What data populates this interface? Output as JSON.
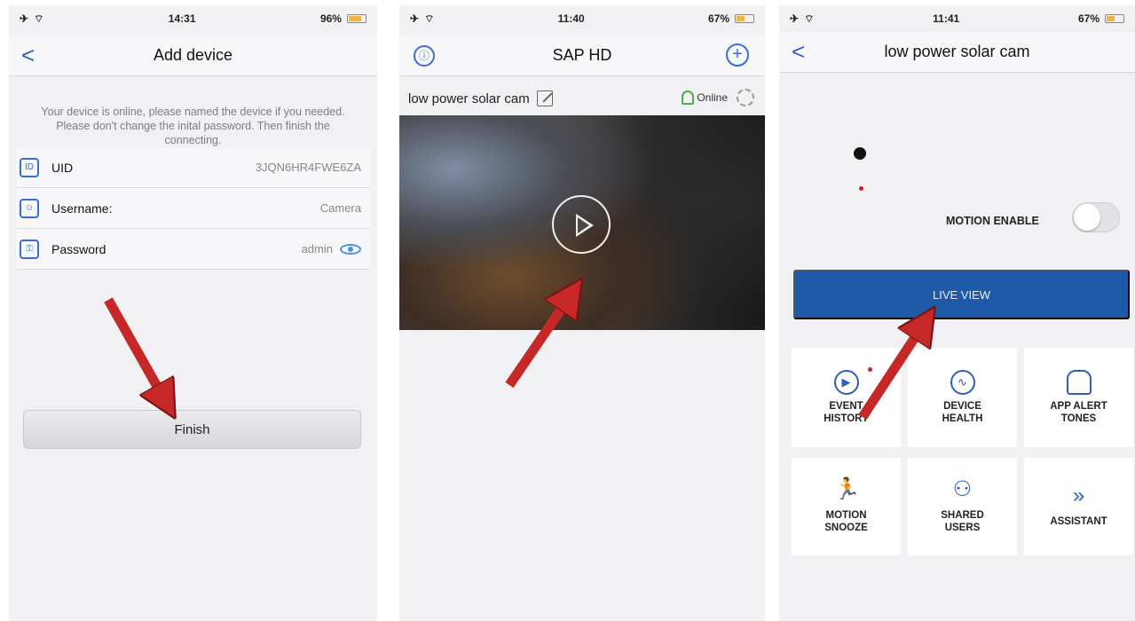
{
  "panel1": {
    "status": {
      "time": "14:31",
      "battery": "96%"
    },
    "nav": {
      "title": "Add device",
      "back": "<"
    },
    "info": "Your device is online, please named the device if you needed. Please don't change the inital password. Then finish the connecting.",
    "rows": [
      {
        "label": "UID",
        "value": "3JQN6HR4FWE6ZA",
        "icon": "uid-icon"
      },
      {
        "label": "Username:",
        "value": "Camera",
        "icon": "user-icon"
      },
      {
        "label": "Password",
        "value": "admin",
        "icon": "password-icon"
      }
    ],
    "finish_label": "Finish"
  },
  "panel2": {
    "status": {
      "time": "11:40",
      "battery": "67%"
    },
    "nav": {
      "title": "SAP HD"
    },
    "device_name": "low power solar cam",
    "status_text": "Online"
  },
  "panel3": {
    "status": {
      "time": "11:41",
      "battery": "67%"
    },
    "nav": {
      "title": "low power solar cam",
      "back": "<"
    },
    "motion_label": "MOTION ENABLE",
    "live_label": "LIVE VIEW",
    "tiles": [
      {
        "label": "EVENT\nHISTORY",
        "icon": "event-history-icon"
      },
      {
        "label": "DEVICE\nHEALTH",
        "icon": "device-health-icon"
      },
      {
        "label": "APP ALERT\nTONES",
        "icon": "bell-icon"
      },
      {
        "label": "MOTION\nSNOOZE",
        "icon": "motion-snooze-icon"
      },
      {
        "label": "SHARED\nUSERS",
        "icon": "shared-users-icon"
      },
      {
        "label": "ASSISTANT",
        "icon": "chevrons-right-icon"
      }
    ]
  },
  "colors": {
    "accent": "#1f5aa8",
    "arrow": "#c62828",
    "background": "#f1f1f4"
  }
}
